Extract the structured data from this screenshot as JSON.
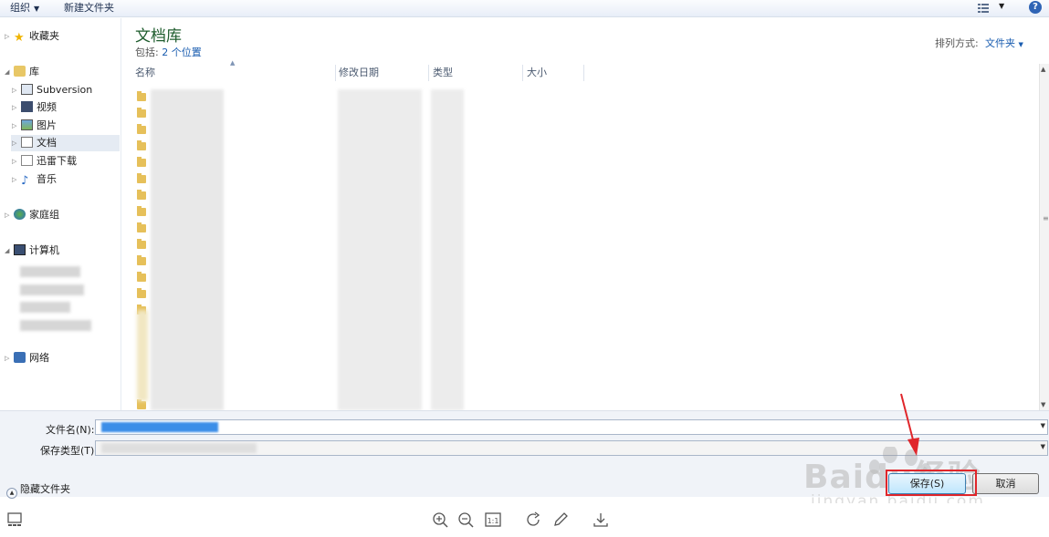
{
  "toolbar": {
    "organize": "组织",
    "new_folder": "新建文件夹",
    "help": "?"
  },
  "nav": {
    "favorites": "收藏夹",
    "libraries": "库",
    "lib_items": [
      "Subversion",
      "视频",
      "图片",
      "文档",
      "迅雷下载",
      "音乐"
    ],
    "homegroup": "家庭组",
    "computer": "计算机",
    "network": "网络"
  },
  "main": {
    "title": "文档库",
    "includes_label": "包括:",
    "includes_link": "2 个位置",
    "sort_label": "排列方式:",
    "sort_value": "文件夹"
  },
  "columns": [
    "名称",
    "修改日期",
    "类型",
    "大小"
  ],
  "form": {
    "filename_label": "文件名(N):",
    "filetype_label": "保存类型(T):",
    "hide_folders": "隐藏文件夹",
    "save_button": "保存(S)",
    "cancel_button": "取消"
  },
  "watermark": {
    "text": "Baidu经验",
    "sub": "jingyan.baidu.com"
  },
  "colors": {
    "accent": "#1a5db0",
    "title_green": "#1e5c2d",
    "highlight_red": "#e0262b",
    "selection_blue": "#3b8ee8"
  },
  "icons": [
    "zoom-in-icon",
    "zoom-out-icon",
    "actual-size-icon",
    "rotate-icon",
    "edit-icon",
    "download-icon"
  ]
}
